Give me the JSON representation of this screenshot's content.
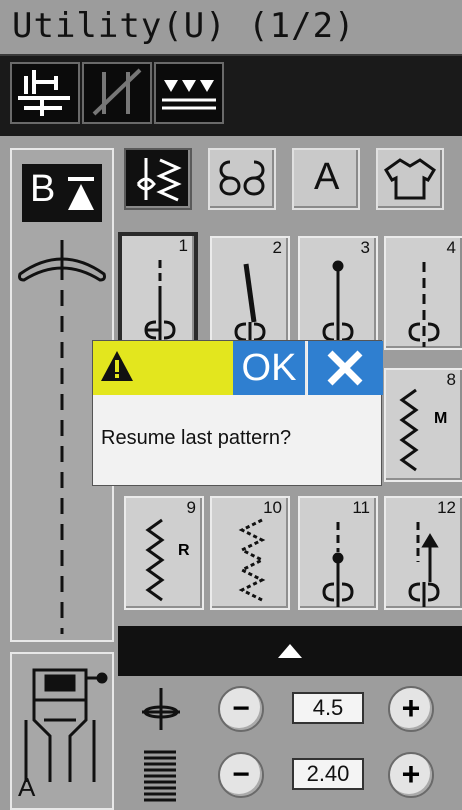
{
  "header": {
    "title": "Utility(U) (1/2)"
  },
  "toolbar": {
    "buttons": [
      {
        "icon": "feed-dog-icon"
      },
      {
        "icon": "twin-needle-icon"
      },
      {
        "icon": "stitch-width-icon"
      }
    ]
  },
  "side_panel": {
    "badge": "B",
    "foot_label": "A"
  },
  "categories": [
    {
      "icon": "utility-stitch-icon",
      "selected": true
    },
    {
      "icon": "decorative-stitch-icon",
      "selected": false
    },
    {
      "icon": "letter-icon",
      "label": "A",
      "selected": false
    },
    {
      "icon": "garment-icon",
      "selected": false
    }
  ],
  "patterns": [
    {
      "number": "1",
      "selected": true
    },
    {
      "number": "2"
    },
    {
      "number": "3"
    },
    {
      "number": "4"
    },
    {
      "number": "8",
      "letter": "M"
    },
    {
      "number": "9",
      "letter": "R"
    },
    {
      "number": "10"
    },
    {
      "number": "11"
    },
    {
      "number": "12"
    }
  ],
  "settings": {
    "width": {
      "value": "4.5",
      "minus": "−",
      "plus": "+"
    },
    "length": {
      "value": "2.40",
      "minus": "−",
      "plus": "+"
    }
  },
  "dialog": {
    "ok_label": "OK",
    "message": "Resume last pattern?"
  },
  "colors": {
    "warning": "#e3e61e",
    "dialog_button": "#2f7fd0",
    "background": "#9d9d9d"
  }
}
